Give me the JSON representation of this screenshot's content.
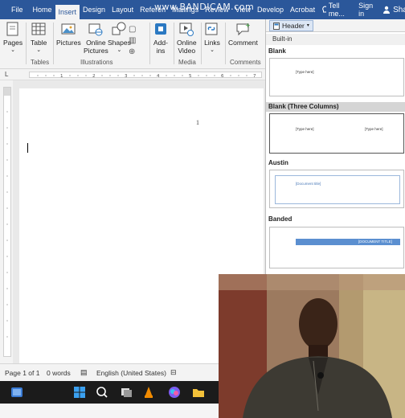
{
  "tabs": [
    {
      "label": "File"
    },
    {
      "label": "Home"
    },
    {
      "label": "Insert"
    },
    {
      "label": "Design"
    },
    {
      "label": "Layout"
    },
    {
      "label": "Referen"
    },
    {
      "label": "Mailings"
    },
    {
      "label": "Review"
    },
    {
      "label": "View"
    },
    {
      "label": "Develop"
    },
    {
      "label": "Acrobat"
    }
  ],
  "watermark": "www.BANDICAM.com",
  "tell_me": "Tell me...",
  "sign_in": "Sign in",
  "share": "Share",
  "ribbon": {
    "pages": "Pages",
    "table": "Table",
    "pictures": "Pictures",
    "online_pictures_1": "Online",
    "online_pictures_2": "Pictures",
    "shapes": "Shapes",
    "addins_1": "Add-",
    "addins_2": "ins",
    "online_video_1": "Online",
    "online_video_2": "Video",
    "links": "Links",
    "comment": "Comment",
    "groups": {
      "tables": "Tables",
      "illustrations": "Illustrations",
      "media": "Media",
      "comments": "Comments"
    }
  },
  "header_menu": {
    "button": "Header",
    "section": "Built-in",
    "items": [
      {
        "title": "Blank",
        "placeholders": [
          "[Type here]"
        ]
      },
      {
        "title": "Blank (Three Columns)",
        "placeholders": [
          "[Type here]",
          "[Type here]"
        ]
      },
      {
        "title": "Austin",
        "placeholders": [
          "[Document title]"
        ]
      },
      {
        "title": "Banded",
        "placeholders": [
          "[DOCUMENT TITLE]"
        ]
      }
    ]
  },
  "document": {
    "page_number": "1"
  },
  "status": {
    "page": "Page 1 of 1",
    "words": "0 words",
    "language": "English (United States)"
  },
  "colors": {
    "word_blue": "#2b579a",
    "accent_band": "#5b8fd0"
  }
}
